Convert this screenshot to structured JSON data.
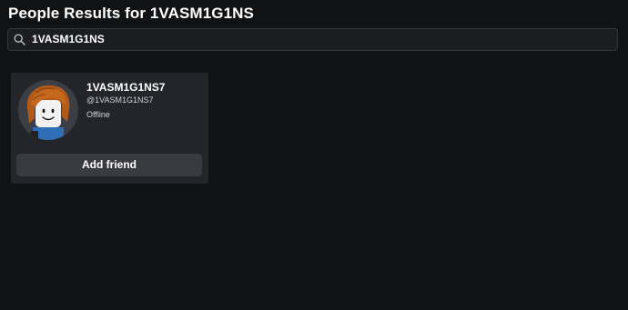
{
  "header": {
    "title": "People Results for 1VASM1G1NS"
  },
  "search": {
    "value": "1VASM1G1NS",
    "icon": "search-icon"
  },
  "results": [
    {
      "display_name": "1VASM1G1NS7",
      "username": "@1VASM1G1NS7",
      "status": "Offline",
      "action_label": "Add friend"
    }
  ],
  "colors": {
    "background": "#111214",
    "card": "#23252b",
    "button": "#393b40",
    "search_bg": "#1b1d21"
  }
}
